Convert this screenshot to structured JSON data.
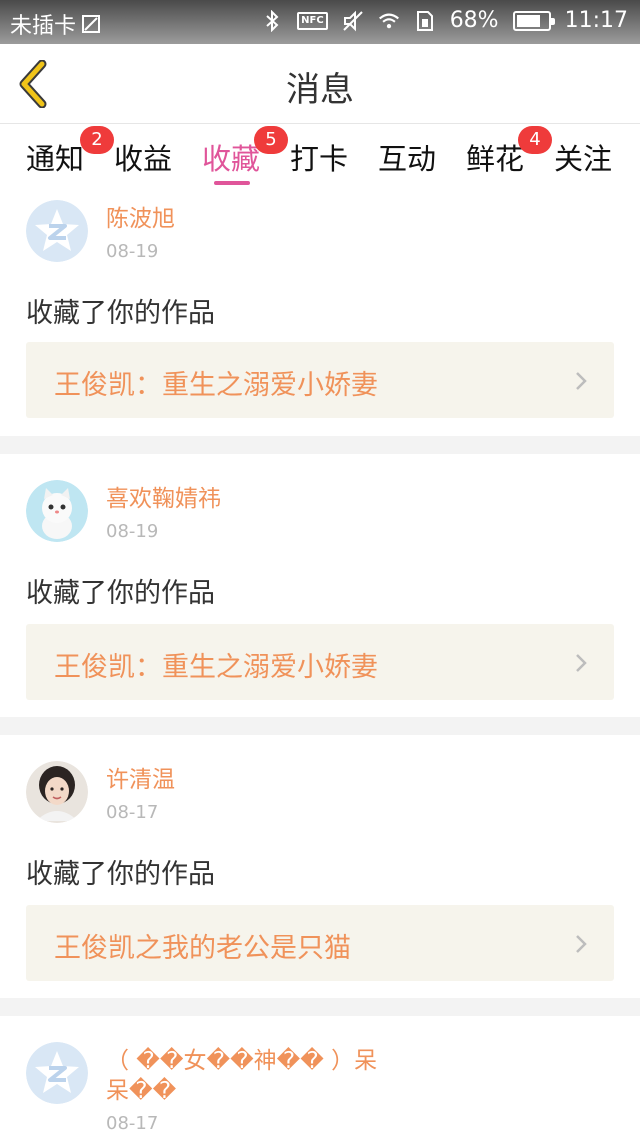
{
  "status_bar": {
    "carrier": "未插卡",
    "battery": "68%",
    "time": "11:17",
    "nfc_label": "NFC"
  },
  "nav": {
    "title": "消息"
  },
  "tabs": [
    {
      "label": "通知",
      "badge": "2"
    },
    {
      "label": "收益",
      "badge": ""
    },
    {
      "label": "收藏",
      "badge": "5",
      "active": true
    },
    {
      "label": "打卡",
      "badge": ""
    },
    {
      "label": "互动",
      "badge": ""
    },
    {
      "label": "鲜花",
      "badge": "4"
    },
    {
      "label": "关注",
      "badge": ""
    }
  ],
  "messages": [
    {
      "user": "陈波旭",
      "date": "08-19",
      "action": "收藏了你的作品",
      "work": "王俊凯：重生之溺爱小娇妻",
      "avatar": "default-avatar"
    },
    {
      "user": "喜欢鞠婧祎",
      "date": "08-19",
      "action": "收藏了你的作品",
      "work": "王俊凯：重生之溺爱小娇妻",
      "avatar": "cat-avatar"
    },
    {
      "user": "许清温",
      "date": "08-17",
      "action": "收藏了你的作品",
      "work": "王俊凯之我的老公是只猫",
      "avatar": "girl-photo-avatar"
    },
    {
      "user_line1": "（ ��女��神�� ）呆",
      "user_line2": "呆��",
      "date": "08-17",
      "avatar": "default-avatar"
    }
  ],
  "colors": {
    "accent": "#e0559a",
    "name": "#f0925a",
    "badge": "#ef3b3b",
    "back_icon": "#f0c419"
  }
}
